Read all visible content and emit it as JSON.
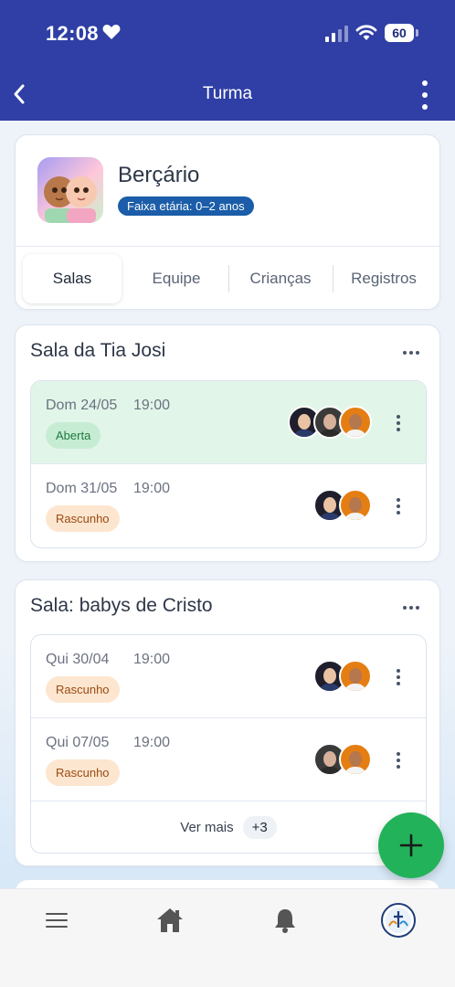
{
  "status_bar": {
    "time": "12:08",
    "battery": "60"
  },
  "nav": {
    "title": "Turma"
  },
  "class_info": {
    "name": "Berçário",
    "age_badge": "Faixa etária: 0–2 anos"
  },
  "tabs": [
    {
      "label": "Salas",
      "active": true
    },
    {
      "label": "Equipe",
      "active": false
    },
    {
      "label": "Crianças",
      "active": false
    },
    {
      "label": "Registros",
      "active": false
    }
  ],
  "rooms": [
    {
      "title": "Sala da Tia Josi",
      "sessions": [
        {
          "date": "Dom 24/05",
          "time": "19:00",
          "status": "Aberta"
        },
        {
          "date": "Dom 31/05",
          "time": "19:00",
          "status": "Rascunho"
        }
      ]
    },
    {
      "title": "Sala: babys de Cristo",
      "sessions": [
        {
          "date": "Qui 30/04",
          "time": "19:00",
          "status": "Rascunho"
        },
        {
          "date": "Qui 07/05",
          "time": "19:00",
          "status": "Rascunho"
        }
      ],
      "see_more": {
        "label": "Ver mais",
        "count": "+3"
      }
    }
  ],
  "bottom_nav": [
    "menu-icon",
    "home-icon",
    "bell-icon",
    "church-logo"
  ],
  "colors": {
    "header": "#2f3fa5",
    "open_status": "#c7ecd4",
    "draft_status": "#fde6d0",
    "fab": "#22b25a"
  }
}
